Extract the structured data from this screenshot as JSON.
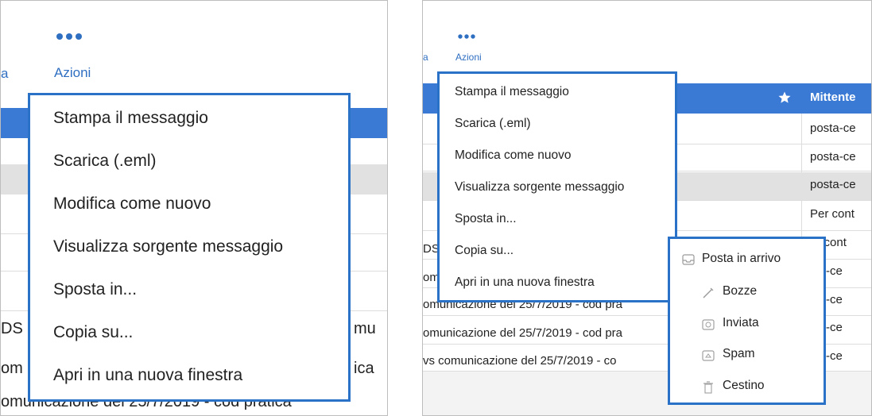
{
  "left": {
    "toolbar": {
      "actions_label": "Azioni",
      "prev_label_fragment": "a"
    },
    "menu": [
      "Stampa il messaggio",
      "Scarica (.eml)",
      "Modifica come nuovo",
      "Visualizza sorgente messaggio",
      "Sposta in...",
      "Copia su...",
      "Apri in una nuova finestra"
    ],
    "background_rows": {
      "r1_left": "DS",
      "r1_right": "mu",
      "r2_left": "om",
      "r2_right": "ica",
      "r3": "omunicazione del 25/7/2019 - cod pratica"
    }
  },
  "right": {
    "toolbar": {
      "actions_label": "Azioni",
      "prev_label_fragment": "a"
    },
    "header": {
      "sender_label": "Mittente"
    },
    "menu": [
      "Stampa il messaggio",
      "Scarica (.eml)",
      "Modifica come nuovo",
      "Visualizza sorgente messaggio",
      "Sposta in...",
      "Copia su...",
      "Apri in una nuova finestra"
    ],
    "submenu": [
      {
        "label": "Posta in arrivo",
        "icon": "inbox-icon"
      },
      {
        "label": "Bozze",
        "icon": "pencil-icon"
      },
      {
        "label": "Inviata",
        "icon": "sent-icon"
      },
      {
        "label": "Spam",
        "icon": "spam-icon"
      },
      {
        "label": "Cestino",
        "icon": "trash-icon"
      }
    ],
    "senders": [
      "posta-ce",
      "posta-ce",
      "posta-ce",
      "Per cont",
      "er cont",
      "sta-ce",
      "sta-ce",
      "sta-ce",
      "sta-ce"
    ],
    "background_rows": {
      "r1_left": "DS",
      "r2_left": "om",
      "r3": "omunicazione del 25/7/2019 - cod pra",
      "r4": "omunicazione del 25/7/2019 - cod pra",
      "r5": "vs comunicazione del 25/7/2019 - co"
    }
  },
  "colors": {
    "accent": "#2a72c8",
    "header_blue": "#3a7ad5",
    "selected_row": "#e1e1e1"
  }
}
